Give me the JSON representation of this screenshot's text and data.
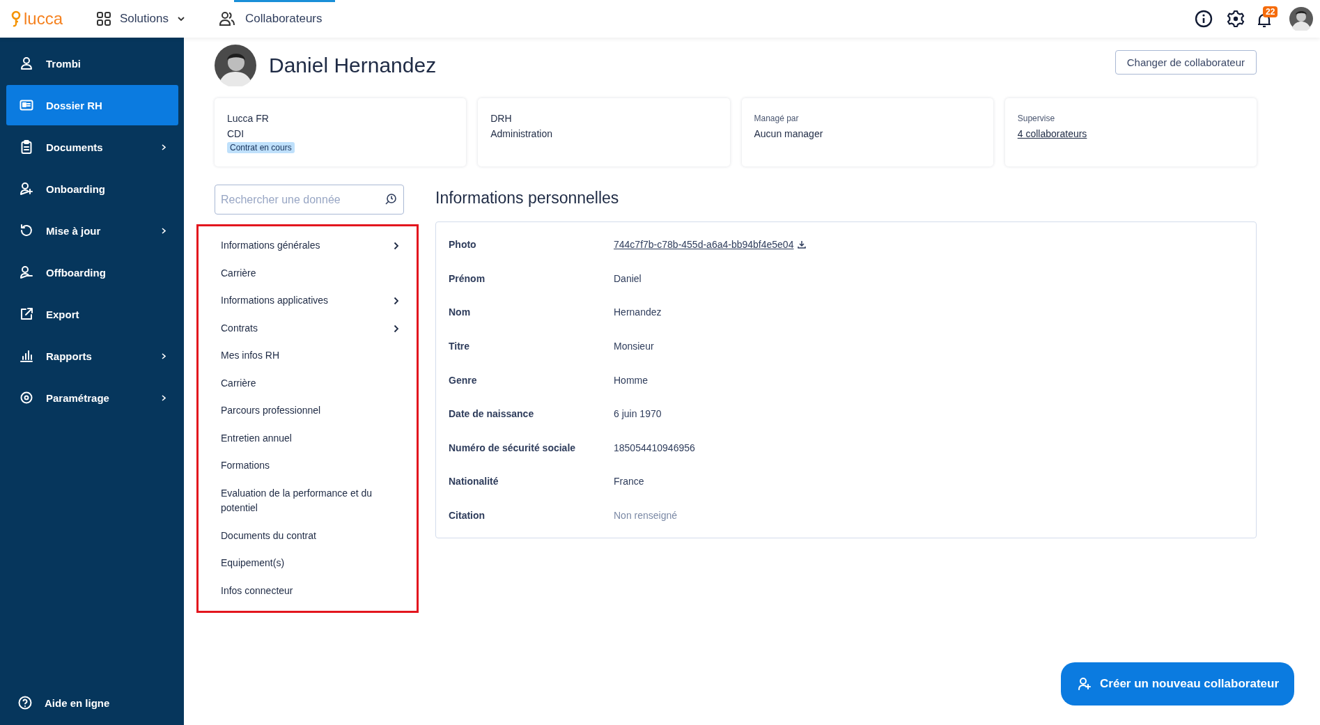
{
  "topbar": {
    "logo": "lucca",
    "solutions": "Solutions",
    "app": {
      "label": "Collaborateurs",
      "selected": true
    },
    "notifications": "22"
  },
  "sidebar": {
    "items": [
      {
        "label": "Trombi",
        "selected": false,
        "expandable": false
      },
      {
        "label": "Dossier RH",
        "selected": true,
        "expandable": false
      },
      {
        "label": "Documents",
        "selected": false,
        "expandable": true
      },
      {
        "label": "Onboarding",
        "selected": false,
        "expandable": false
      },
      {
        "label": "Mise à jour",
        "selected": false,
        "expandable": true
      },
      {
        "label": "Offboarding",
        "selected": false,
        "expandable": false
      },
      {
        "label": "Export",
        "selected": false,
        "expandable": false
      },
      {
        "label": "Rapports",
        "selected": false,
        "expandable": true
      },
      {
        "label": "Paramétrage",
        "selected": false,
        "expandable": true
      }
    ],
    "footer": "Aide en ligne"
  },
  "header": {
    "name": "Daniel Hernandez",
    "button": "Changer de collaborateur"
  },
  "cards": [
    {
      "lines": [
        {
          "kind": "text",
          "text": "Lucca FR"
        },
        {
          "kind": "text",
          "text": "CDI"
        },
        {
          "kind": "tag",
          "text": "Contrat en cours"
        }
      ]
    },
    {
      "lines": [
        {
          "kind": "text",
          "text": "DRH"
        },
        {
          "kind": "text",
          "text": "Administration"
        }
      ]
    },
    {
      "lines": [
        {
          "kind": "caption",
          "text": "Managé par"
        },
        {
          "kind": "text",
          "text": "Aucun manager"
        }
      ]
    },
    {
      "lines": [
        {
          "kind": "caption",
          "text": "Supervise"
        },
        {
          "kind": "link",
          "text": "4 collaborateurs"
        }
      ]
    }
  ],
  "search": {
    "placeholder": "Rechercher une donnée"
  },
  "nav": {
    "highlighted": true,
    "items": [
      {
        "label": "Informations générales",
        "expandable": true
      },
      {
        "label": "Carrière",
        "expandable": false
      },
      {
        "label": "Informations applicatives",
        "expandable": true
      },
      {
        "label": "Contrats",
        "expandable": true
      },
      {
        "label": "Mes infos RH",
        "expandable": false
      },
      {
        "label": "Carrière",
        "expandable": false
      },
      {
        "label": "Parcours professionnel",
        "expandable": false
      },
      {
        "label": "Entretien annuel",
        "expandable": false
      },
      {
        "label": "Formations",
        "expandable": false
      },
      {
        "label": "Evaluation de la performance et du potentiel",
        "expandable": false
      },
      {
        "label": "Documents du contrat",
        "expandable": false
      },
      {
        "label": "Equipement(s)",
        "expandable": false
      },
      {
        "label": "Infos connecteur",
        "expandable": false
      }
    ]
  },
  "section": {
    "title": "Informations personnelles",
    "fields": [
      {
        "label": "Photo",
        "value": "744c7f7b-c78b-455d-a6a4-bb94bf4e5e04",
        "kind": "file"
      },
      {
        "label": "Prénom",
        "value": "Daniel",
        "kind": "text"
      },
      {
        "label": "Nom",
        "value": "Hernandez",
        "kind": "text"
      },
      {
        "label": "Titre",
        "value": "Monsieur",
        "kind": "text"
      },
      {
        "label": "Genre",
        "value": "Homme",
        "kind": "text"
      },
      {
        "label": "Date de naissance",
        "value": "6 juin 1970",
        "kind": "text"
      },
      {
        "label": "Numéro de sécurité sociale",
        "value": "185054410946956",
        "kind": "text"
      },
      {
        "label": "Nationalité",
        "value": "France",
        "kind": "text"
      },
      {
        "label": "Citation",
        "value": "Non renseigné",
        "kind": "empty"
      }
    ]
  },
  "create_button": "Créer un nouveau collaborateur"
}
